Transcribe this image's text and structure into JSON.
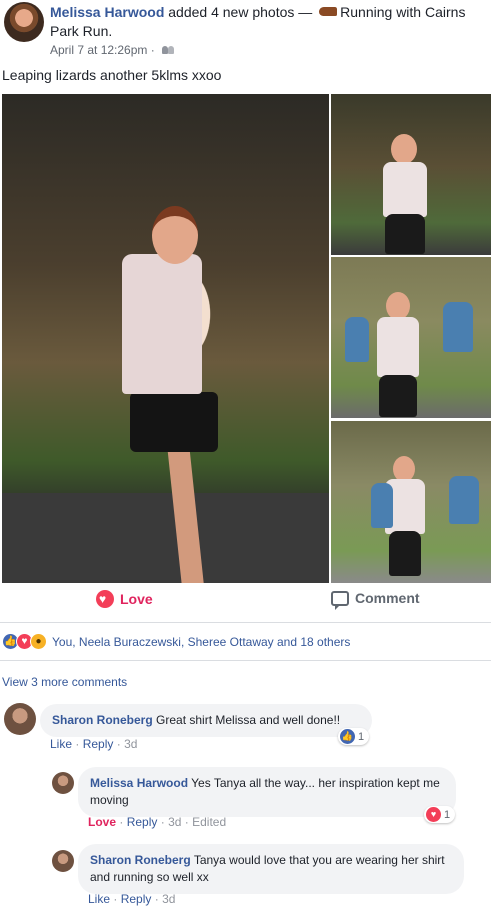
{
  "post": {
    "author": "Melissa Harwood",
    "action_text": "added 4 new photos —",
    "activity_text": "Running with Cairns Park Run.",
    "timestamp": "April 7 at 12:26pm",
    "separator": "·",
    "text": "Leaping lizards another 5klms xxoo",
    "audience_icon": "friends-icon"
  },
  "actions": {
    "love_label": "Love",
    "comment_label": "Comment"
  },
  "reactions": {
    "summary": "You, Neela Buraczewski, Sheree Ottaway and 18 others",
    "icons": [
      "like-icon",
      "love-icon",
      "wow-icon"
    ]
  },
  "view_more": "View 3 more comments",
  "comments": [
    {
      "author": "Sharon Roneberg",
      "text": "Great shirt Melissa and well done!!",
      "like": "Like",
      "reply": "Reply",
      "time": "3d",
      "reaction_count": "1"
    }
  ],
  "replies": [
    {
      "author": "Melissa Harwood",
      "text": "Yes Tanya all the way... her inspiration kept me moving",
      "like": "Love",
      "reply": "Reply",
      "time": "3d",
      "edited": "Edited",
      "reaction_count": "1"
    },
    {
      "author": "Sharon Roneberg",
      "text": "Tanya would love that you are wearing her shirt and running so well xx",
      "like": "Like",
      "reply": "Reply",
      "time": "3d"
    }
  ],
  "colors": {
    "link": "#365899",
    "love": "#e0245e",
    "like_blue": "#4267b2",
    "bubble_bg": "#f2f3f5"
  }
}
